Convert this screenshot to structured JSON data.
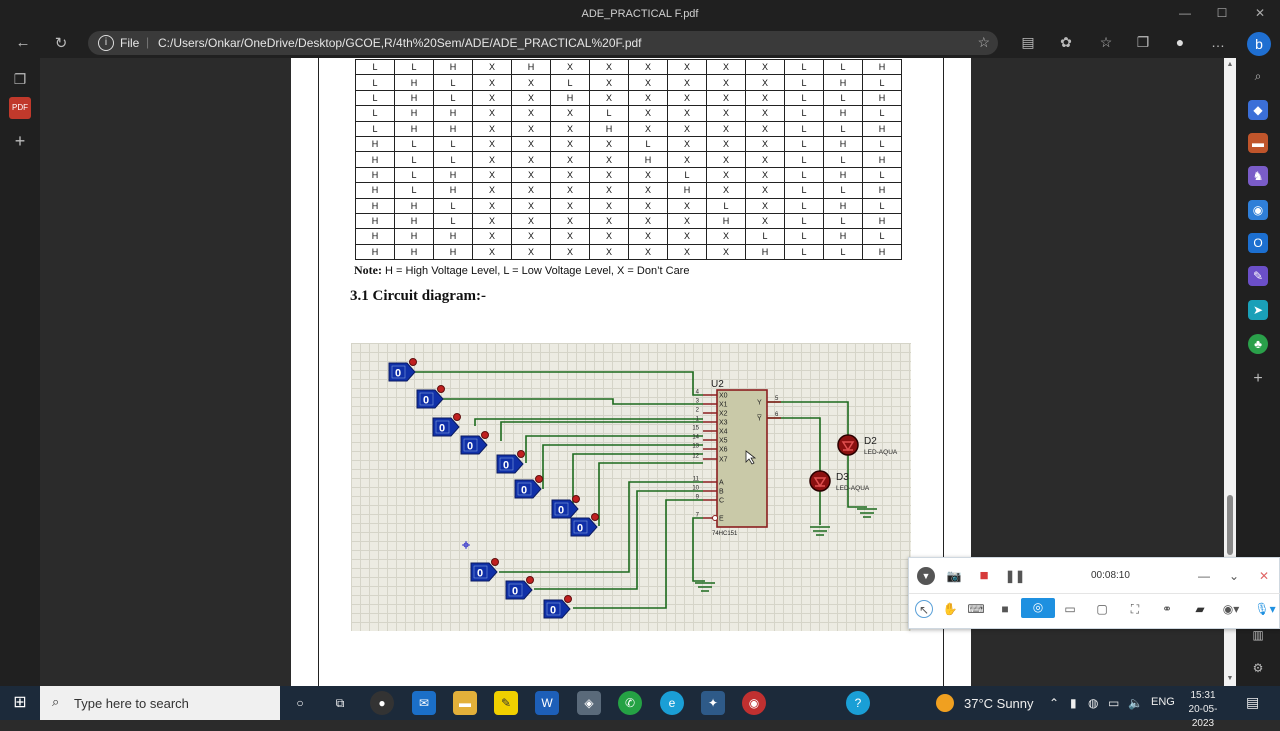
{
  "window": {
    "title": "ADE_PRACTICAL F.pdf",
    "minimize": "—",
    "maximize": "☐",
    "close": "✕"
  },
  "address": {
    "file_label": "File",
    "url": "C:/Users/Onkar/OneDrive/Desktop/GCOE,R/4th%20Sem/ADE/ADE_PRACTICAL%20F.pdf"
  },
  "truth_table": {
    "rows": [
      [
        "L",
        "L",
        "H",
        "X",
        "H",
        "X",
        "X",
        "X",
        "X",
        "X",
        "X",
        "L",
        "L",
        "H"
      ],
      [
        "L",
        "H",
        "L",
        "X",
        "X",
        "L",
        "X",
        "X",
        "X",
        "X",
        "X",
        "L",
        "H",
        "L"
      ],
      [
        "L",
        "H",
        "L",
        "X",
        "X",
        "H",
        "X",
        "X",
        "X",
        "X",
        "X",
        "L",
        "L",
        "H"
      ],
      [
        "L",
        "H",
        "H",
        "X",
        "X",
        "X",
        "L",
        "X",
        "X",
        "X",
        "X",
        "L",
        "H",
        "L"
      ],
      [
        "L",
        "H",
        "H",
        "X",
        "X",
        "X",
        "H",
        "X",
        "X",
        "X",
        "X",
        "L",
        "L",
        "H"
      ],
      [
        "H",
        "L",
        "L",
        "X",
        "X",
        "X",
        "X",
        "L",
        "X",
        "X",
        "X",
        "L",
        "H",
        "L"
      ],
      [
        "H",
        "L",
        "L",
        "X",
        "X",
        "X",
        "X",
        "H",
        "X",
        "X",
        "X",
        "L",
        "L",
        "H"
      ],
      [
        "H",
        "L",
        "H",
        "X",
        "X",
        "X",
        "X",
        "X",
        "L",
        "X",
        "X",
        "L",
        "H",
        "L"
      ],
      [
        "H",
        "L",
        "H",
        "X",
        "X",
        "X",
        "X",
        "X",
        "H",
        "X",
        "X",
        "L",
        "L",
        "H"
      ],
      [
        "H",
        "H",
        "L",
        "X",
        "X",
        "X",
        "X",
        "X",
        "X",
        "L",
        "X",
        "L",
        "H",
        "L"
      ],
      [
        "H",
        "H",
        "L",
        "X",
        "X",
        "X",
        "X",
        "X",
        "X",
        "H",
        "X",
        "L",
        "L",
        "H"
      ],
      [
        "H",
        "H",
        "H",
        "X",
        "X",
        "X",
        "X",
        "X",
        "X",
        "X",
        "L",
        "L",
        "H",
        "L"
      ],
      [
        "H",
        "H",
        "H",
        "X",
        "X",
        "X",
        "X",
        "X",
        "X",
        "X",
        "H",
        "L",
        "L",
        "H"
      ]
    ]
  },
  "note": {
    "label": "Note:",
    "text": " H = High Voltage Level, L = Low Voltage Level, X = Don’t Care"
  },
  "section_heading": "3.1 Circuit diagram:-",
  "circuit": {
    "ic_ref": "U2",
    "ic_part": "74HC151",
    "ic_pins_left": [
      "X0",
      "X1",
      "X2",
      "X3",
      "X4",
      "X5",
      "X6",
      "X7",
      "A",
      "B",
      "C",
      "E"
    ],
    "ic_pin_numbers_left": [
      "4",
      "3",
      "2",
      "1",
      "15",
      "14",
      "13",
      "12",
      "11",
      "10",
      "9",
      "7"
    ],
    "ic_pins_right": [
      "Y",
      "Y̅"
    ],
    "ic_pin_numbers_right": [
      "5",
      "6"
    ],
    "logic_state": "0",
    "led1_ref": "D2",
    "led1_part": "LED-AQUA",
    "led2_ref": "D3",
    "led2_part": "LED-AQUA"
  },
  "recorder": {
    "timer": "00:08:10"
  },
  "taskbar": {
    "search_placeholder": "Type here to search",
    "weather": "37°C  Sunny",
    "language": "ENG",
    "time": "15:31",
    "date": "20-05-2023"
  }
}
